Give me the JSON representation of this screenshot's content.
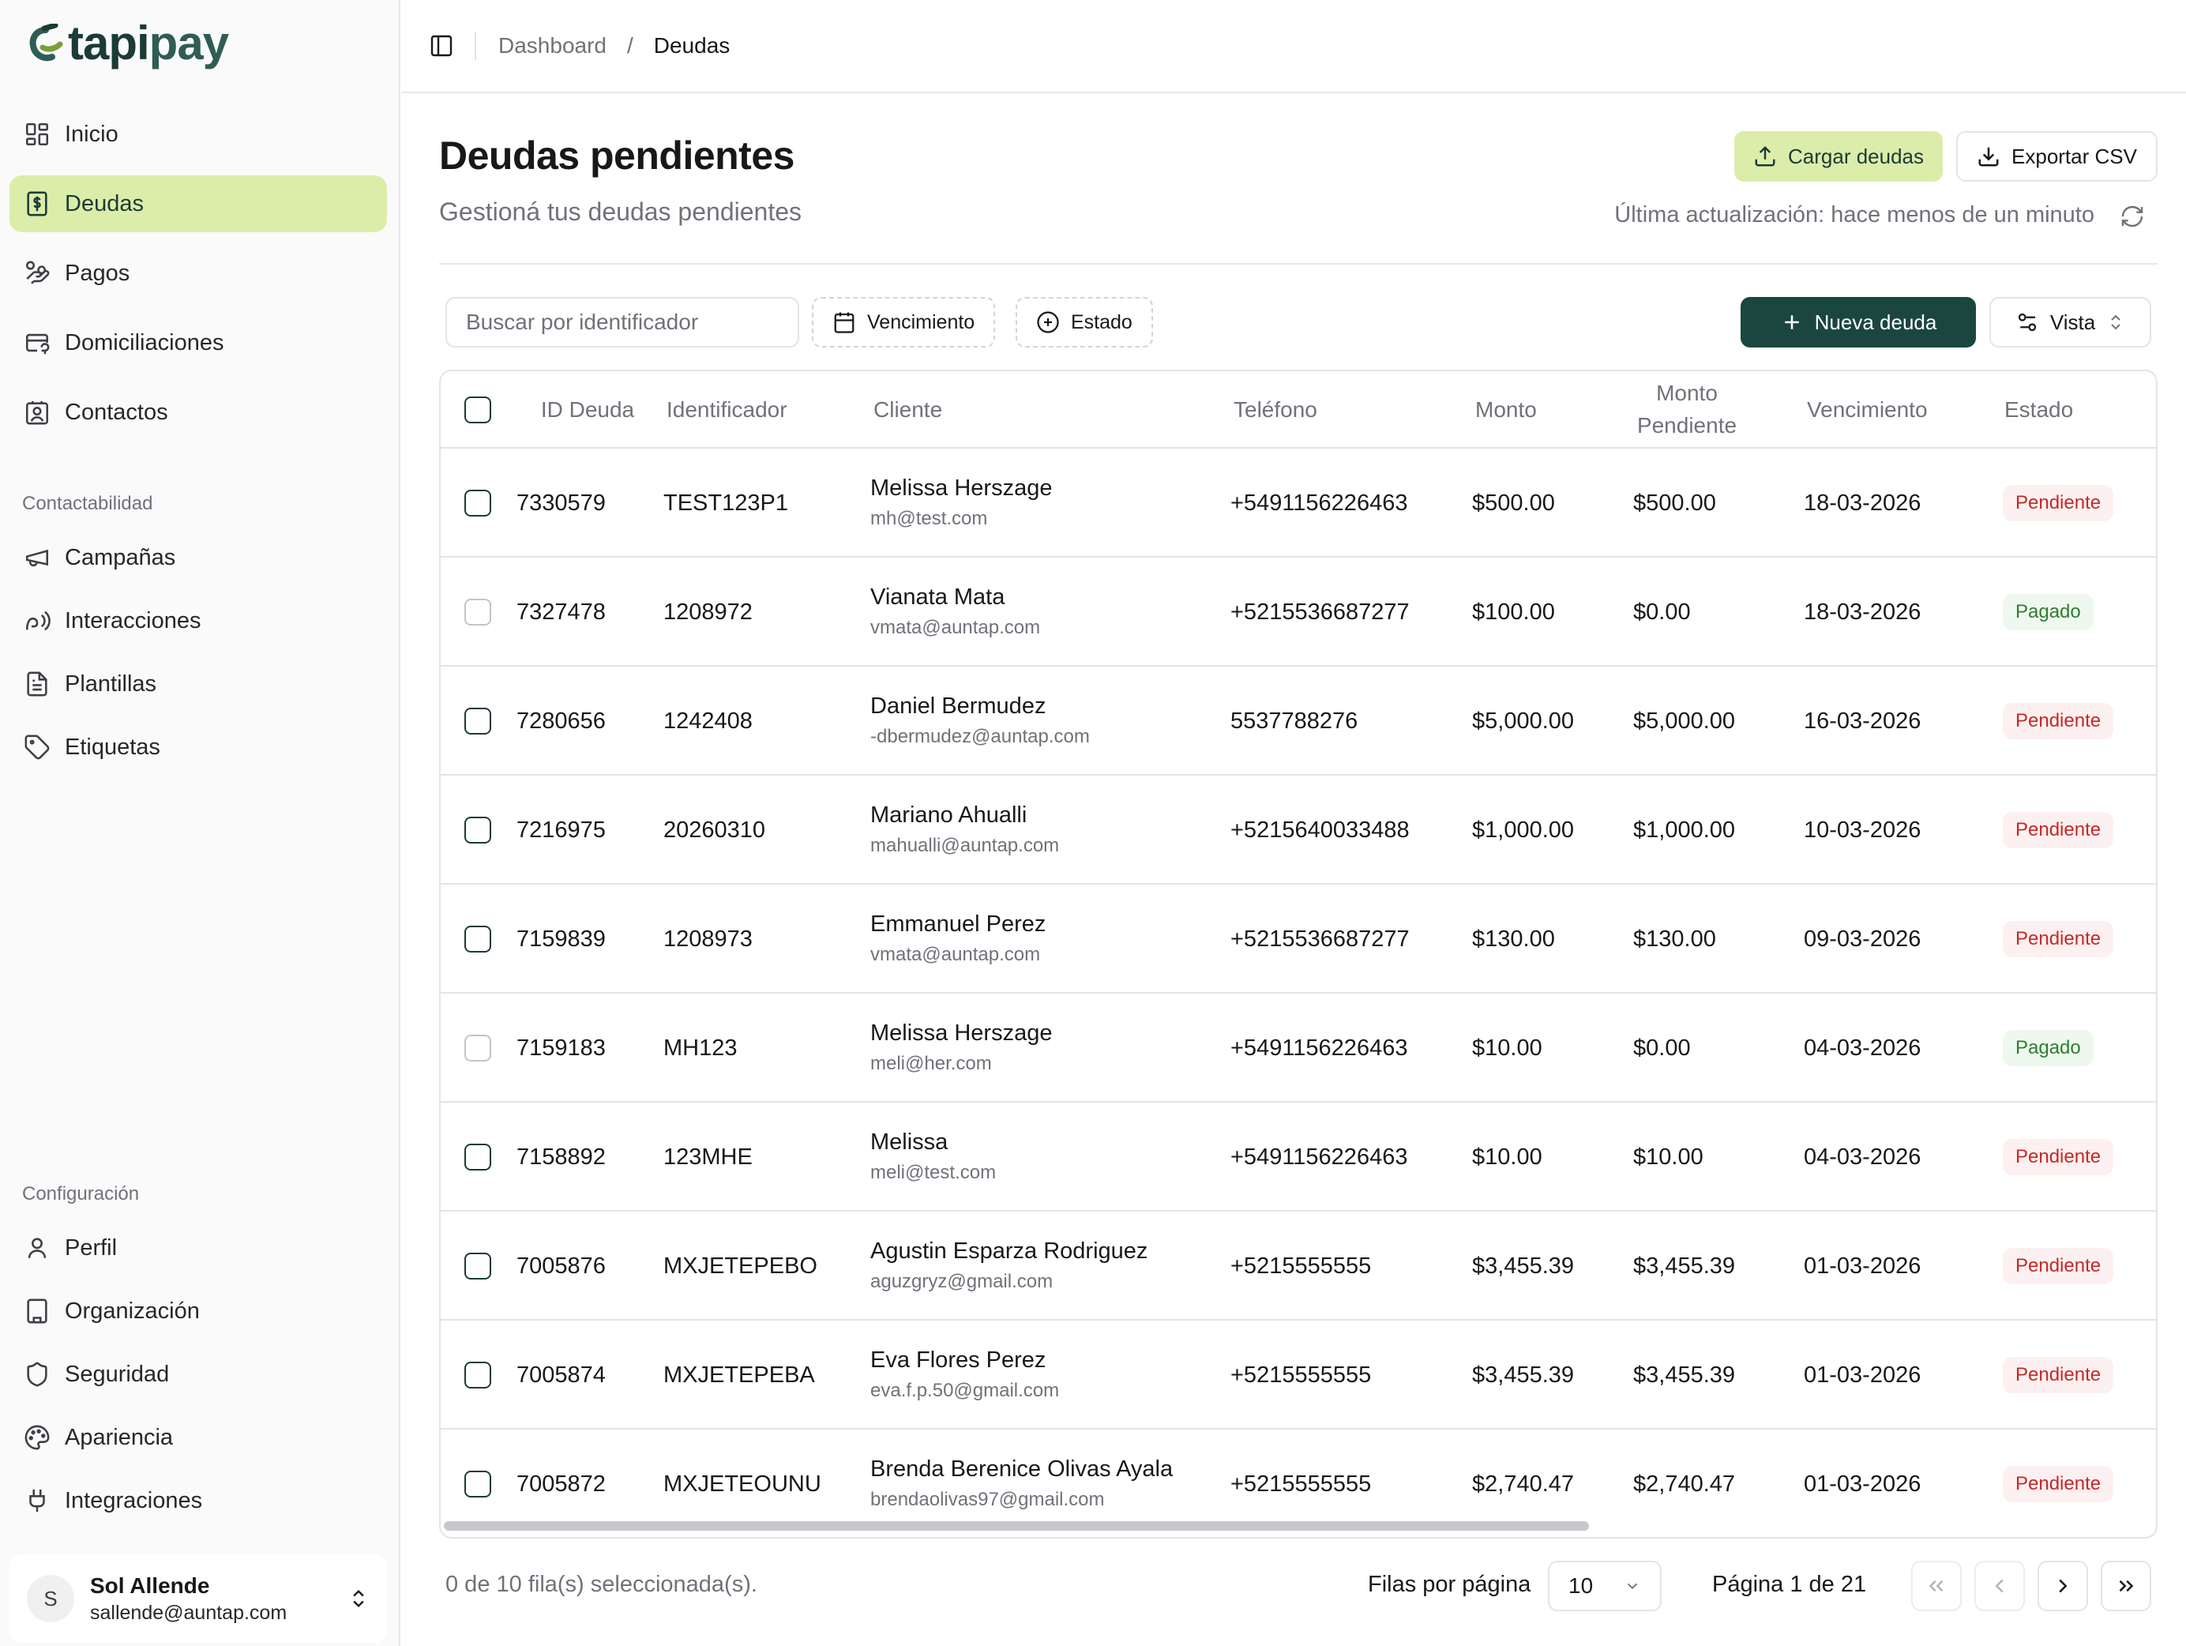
{
  "brand": {
    "name_part1": "tapi",
    "name_part2": "pay"
  },
  "sidebar": {
    "main_items": [
      {
        "label": "Inicio",
        "icon": "grid-icon"
      },
      {
        "label": "Deudas",
        "icon": "dollar-file-icon",
        "active": true
      },
      {
        "label": "Pagos",
        "icon": "hand-coins-icon"
      },
      {
        "label": "Domiciliaciones",
        "icon": "card-repeat-icon"
      },
      {
        "label": "Contactos",
        "icon": "contact-book-icon"
      }
    ],
    "section_contact": "Contactabilidad",
    "contact_items": [
      {
        "label": "Campañas",
        "icon": "megaphone-icon"
      },
      {
        "label": "Interacciones",
        "icon": "speaking-icon"
      },
      {
        "label": "Plantillas",
        "icon": "document-icon"
      },
      {
        "label": "Etiquetas",
        "icon": "tag-icon"
      }
    ],
    "section_config": "Configuración",
    "config_items": [
      {
        "label": "Perfil",
        "icon": "user-icon"
      },
      {
        "label": "Organización",
        "icon": "building-icon"
      },
      {
        "label": "Seguridad",
        "icon": "shield-icon"
      },
      {
        "label": "Apariencia",
        "icon": "palette-icon"
      },
      {
        "label": "Integraciones",
        "icon": "plug-icon"
      }
    ],
    "user": {
      "initial": "S",
      "name": "Sol Allende",
      "email": "sallende@auntap.com"
    }
  },
  "breadcrumb": {
    "root": "Dashboard",
    "sep": "/",
    "current": "Deudas"
  },
  "header": {
    "title": "Deudas pendientes",
    "subtitle": "Gestioná tus deudas pendientes",
    "cargar_label": "Cargar deudas",
    "exportar_label": "Exportar CSV",
    "last_update": "Última actualización: hace menos de un minuto"
  },
  "toolbar": {
    "search_placeholder": "Buscar por identificador",
    "filter_vencimiento": "Vencimiento",
    "filter_estado": "Estado",
    "nueva_label": "Nueva deuda",
    "vista_label": "Vista"
  },
  "table": {
    "columns": {
      "id": "ID Deuda",
      "identificador": "Identificador",
      "cliente": "Cliente",
      "telefono": "Teléfono",
      "monto": "Monto",
      "pendiente": "Monto Pendiente",
      "vencimiento": "Vencimiento",
      "estado": "Estado"
    },
    "rows": [
      {
        "id": "7330579",
        "identificador": "TEST123P1",
        "name": "Melissa Herszage",
        "email": "mh@test.com",
        "telefono": "+5491156226463",
        "monto": "$500.00",
        "pendiente": "$500.00",
        "vencimiento": "18-03-2026",
        "estado": "Pendiente",
        "status": "pend"
      },
      {
        "id": "7327478",
        "identificador": "1208972",
        "name": "Vianata Mata",
        "email": "vmata@auntap.com",
        "telefono": "+5215536687277",
        "monto": "$100.00",
        "pendiente": "$0.00",
        "vencimiento": "18-03-2026",
        "estado": "Pagado",
        "status": "pag"
      },
      {
        "id": "7280656",
        "identificador": "1242408",
        "name": "Daniel Bermudez",
        "email": "-dbermudez@auntap.com",
        "telefono": "5537788276",
        "monto": "$5,000.00",
        "pendiente": "$5,000.00",
        "vencimiento": "16-03-2026",
        "estado": "Pendiente",
        "status": "pend"
      },
      {
        "id": "7216975",
        "identificador": "20260310",
        "name": "Mariano Ahualli",
        "email": "mahualli@auntap.com",
        "telefono": "+5215640033488",
        "monto": "$1,000.00",
        "pendiente": "$1,000.00",
        "vencimiento": "10-03-2026",
        "estado": "Pendiente",
        "status": "pend"
      },
      {
        "id": "7159839",
        "identificador": "1208973",
        "name": "Emmanuel Perez",
        "email": "vmata@auntap.com",
        "telefono": "+5215536687277",
        "monto": "$130.00",
        "pendiente": "$130.00",
        "vencimiento": "09-03-2026",
        "estado": "Pendiente",
        "status": "pend"
      },
      {
        "id": "7159183",
        "identificador": "MH123",
        "name": "Melissa Herszage",
        "email": "meli@her.com",
        "telefono": "+5491156226463",
        "monto": "$10.00",
        "pendiente": "$0.00",
        "vencimiento": "04-03-2026",
        "estado": "Pagado",
        "status": "pag"
      },
      {
        "id": "7158892",
        "identificador": "123MHE",
        "name": "Melissa",
        "email": "meli@test.com",
        "telefono": "+5491156226463",
        "monto": "$10.00",
        "pendiente": "$10.00",
        "vencimiento": "04-03-2026",
        "estado": "Pendiente",
        "status": "pend"
      },
      {
        "id": "7005876",
        "identificador": "MXJETEPEBO",
        "name": "Agustin Esparza Rodriguez",
        "email": "aguzgryz@gmail.com",
        "telefono": "+5215555555",
        "monto": "$3,455.39",
        "pendiente": "$3,455.39",
        "vencimiento": "01-03-2026",
        "estado": "Pendiente",
        "status": "pend"
      },
      {
        "id": "7005874",
        "identificador": "MXJETEPEBA",
        "name": "Eva Flores Perez",
        "email": "eva.f.p.50@gmail.com",
        "telefono": "+5215555555",
        "monto": "$3,455.39",
        "pendiente": "$3,455.39",
        "vencimiento": "01-03-2026",
        "estado": "Pendiente",
        "status": "pend"
      },
      {
        "id": "7005872",
        "identificador": "MXJETEOUNU",
        "name": "Brenda Berenice Olivas Ayala",
        "email": "brendaolivas97@gmail.com",
        "telefono": "+5215555555",
        "monto": "$2,740.47",
        "pendiente": "$2,740.47",
        "vencimiento": "01-03-2026",
        "estado": "Pendiente",
        "status": "pend"
      }
    ]
  },
  "footer": {
    "selected": "0 de 10 fila(s) seleccionada(s).",
    "rows_label": "Filas por página",
    "rows_value": "10",
    "page_info": "Página 1 de 21"
  },
  "colors": {
    "accent": "#dcedaa",
    "primary": "#1a463f",
    "pending": "#c62828",
    "paid": "#2e7d32"
  }
}
